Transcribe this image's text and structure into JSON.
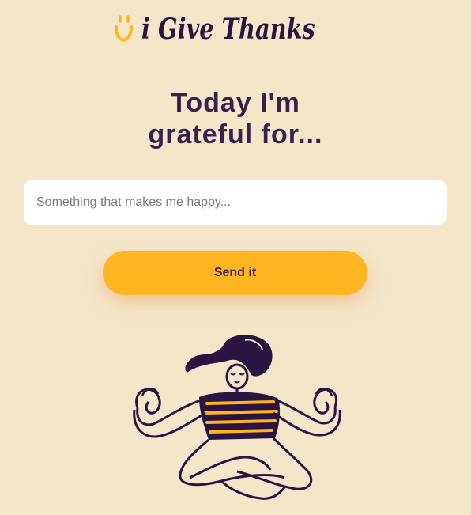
{
  "brand": {
    "name": "i Give Thanks",
    "mark_color": "#ffb51f",
    "text_color": "#2a1442"
  },
  "heading": {
    "line1": "Today I'm",
    "line2": "grateful for..."
  },
  "form": {
    "placeholder": "Something that makes me happy...",
    "value": "",
    "submit_label": "Send it"
  },
  "colors": {
    "background": "#f3e6c9",
    "accent": "#ffb51f",
    "heading": "#3b1f4f"
  },
  "illustration": {
    "icon": "meditating-woman-icon"
  }
}
